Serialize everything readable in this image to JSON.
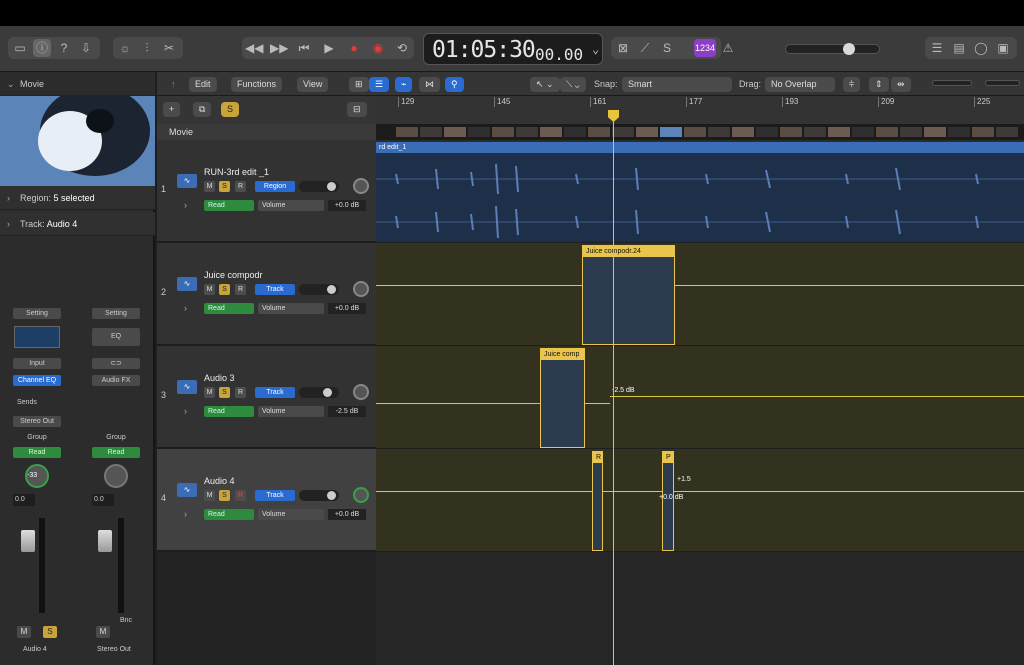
{
  "toolbar": {
    "time_main": "01:05:30",
    "time_frames": "00.00",
    "badge": "1234"
  },
  "editbar": {
    "edit": "Edit",
    "functions": "Functions",
    "view": "View",
    "snap_label": "Snap:",
    "snap_value": "Smart",
    "drag_label": "Drag:",
    "drag_value": "No Overlap"
  },
  "inspector": {
    "title": "Movie",
    "region_label": "Region:",
    "region_value": "5 selected",
    "track_label": "Track:",
    "track_value": "Audio 4"
  },
  "strip1": {
    "setting": "Setting",
    "input": "Input",
    "eq": "Channel EQ",
    "sends": "Sends",
    "out": "Stereo Out",
    "group": "Group",
    "read": "Read",
    "knob": "-33",
    "val": "0.0",
    "m": "M",
    "s": "S",
    "name": "Audio 4"
  },
  "strip2": {
    "setting": "Setting",
    "eq": "EQ",
    "fx": "Audio FX",
    "group": "Group",
    "read": "Read",
    "val": "0.0",
    "bnc": "Bnc",
    "m": "M",
    "name": "Stereo Out"
  },
  "ruler": {
    "marks": [
      "129",
      "145",
      "161",
      "177",
      "193",
      "209",
      "225"
    ]
  },
  "movie_track": "Movie",
  "tracks": [
    {
      "num": "1",
      "name": "RUN-3rd edit _1",
      "badge": "Region",
      "read": "Read",
      "param": "Volume",
      "db": "+0.0 dB"
    },
    {
      "num": "2",
      "name": "Juice compodr",
      "badge": "Track",
      "read": "Read",
      "param": "Volume",
      "db": "+0.0 dB"
    },
    {
      "num": "3",
      "name": "Audio 3",
      "badge": "Track",
      "read": "Read",
      "param": "Volume",
      "db": "-2.5 dB"
    },
    {
      "num": "4",
      "name": "Audio 4",
      "badge": "Track",
      "read": "Read",
      "param": "Volume",
      "db": "+0.0 dB"
    }
  ],
  "regions": {
    "r1": "rd edit_1",
    "r2": "Juice compodr.24",
    "r3": "Juice comp",
    "r4a": "R",
    "r4b": "P"
  },
  "auto": {
    "a3": "-2.5 dB",
    "a4a": "+1.5",
    "a4b": "+0.0 dB"
  },
  "colors": {
    "accent": "#2a6bd1",
    "automation": "#d8c842",
    "region_label": "#e9c54b"
  }
}
